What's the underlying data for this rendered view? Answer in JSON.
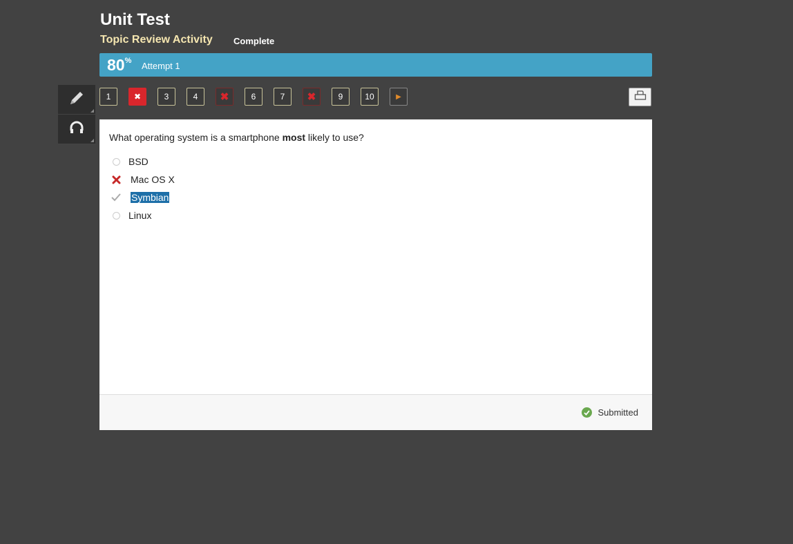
{
  "header": {
    "title": "Unit Test",
    "activity": "Topic Review Activity",
    "status": "Complete"
  },
  "score": {
    "percent": "80",
    "percent_sign": "%",
    "attempt": "Attempt 1"
  },
  "tools": [
    {
      "name": "pencil-icon"
    },
    {
      "name": "headphones-icon"
    }
  ],
  "question_nav": [
    {
      "label": "1",
      "state": "answered"
    },
    {
      "label": "✖",
      "state": "current-wrong"
    },
    {
      "label": "3",
      "state": "answered"
    },
    {
      "label": "4",
      "state": "answered"
    },
    {
      "label": "✖",
      "state": "wrong"
    },
    {
      "label": "6",
      "state": "answered"
    },
    {
      "label": "7",
      "state": "answered"
    },
    {
      "label": "✖",
      "state": "wrong"
    },
    {
      "label": "9",
      "state": "answered"
    },
    {
      "label": "10",
      "state": "answered"
    },
    {
      "label": "▶",
      "state": "next"
    }
  ],
  "question": {
    "text_before": "What operating system is a smartphone ",
    "text_bold": "most",
    "text_after": " likely to use?",
    "options": [
      {
        "label": "BSD",
        "mark": "radio"
      },
      {
        "label": "Mac OS X",
        "mark": "incorrect"
      },
      {
        "label": "Symbian",
        "mark": "correct"
      },
      {
        "label": "Linux",
        "mark": "radio"
      }
    ]
  },
  "footer": {
    "status": "Submitted"
  },
  "colors": {
    "accent": "#44a3c6",
    "wrong": "#d9262c",
    "success": "#6aa84f"
  }
}
